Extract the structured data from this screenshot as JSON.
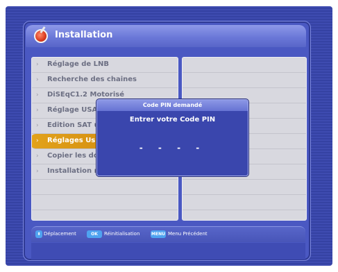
{
  "header": {
    "title": "Installation",
    "icon": "satellite-dish-icon"
  },
  "menu": {
    "items": [
      {
        "label": "Réglage de LNB"
      },
      {
        "label": "Recherche des chaines"
      },
      {
        "label": "DiSEqC1.2 Motorisé"
      },
      {
        "label": "Réglage USA"
      },
      {
        "label": "Edition SAT u"
      },
      {
        "label": "Réglages Usi",
        "selected": true
      },
      {
        "label": "Copier les do"
      },
      {
        "label": "Installation rapide"
      }
    ],
    "arrow_glyph": "›"
  },
  "dialog": {
    "title": "Code PIN demandé",
    "prompt": "Entrer votre Code PIN",
    "pin_display": "- - - -"
  },
  "help": {
    "items": [
      {
        "key": "⬍",
        "label": "Déplacement"
      },
      {
        "key": "OK",
        "label": "Réinitialisation"
      },
      {
        "key": "MENU",
        "label": "Menu Précédent"
      }
    ]
  },
  "colors": {
    "background": "#3e4bb0",
    "selected_item": "#e2a21b",
    "panel": "#d8d8df",
    "key_badge": "#4fa3f0"
  }
}
